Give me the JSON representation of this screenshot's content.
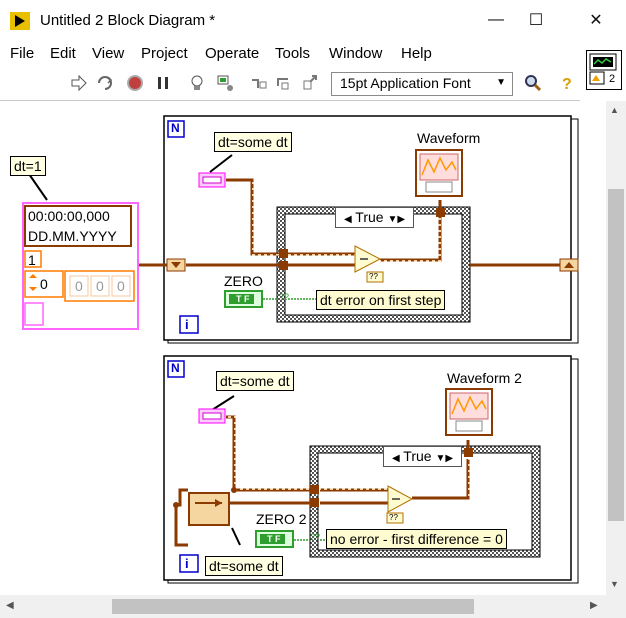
{
  "window": {
    "title": "Untitled 2 Block Diagram *",
    "controls": {
      "minimize": "—",
      "maximize": "☐",
      "close": "✕"
    }
  },
  "menu": [
    "File",
    "Edit",
    "View",
    "Project",
    "Operate",
    "Tools",
    "Window",
    "Help"
  ],
  "toolbar": {
    "font_select": "15pt Application Font",
    "icons": [
      "run-arrow-icon",
      "run-continuously-icon",
      "abort-icon",
      "pause-icon",
      "highlight-bulb-icon",
      "retain-wire-icon",
      "step-into-icon",
      "step-over-icon",
      "step-out-icon",
      "search-icon",
      "help-icon"
    ]
  },
  "context_help": {
    "badge": "2"
  },
  "diagram": {
    "outer_label": "dt=1",
    "timestamp": {
      "time": "00:00:00,000",
      "date": "DD.MM.YYYY"
    },
    "cluster": {
      "n": "1",
      "index": "0",
      "values": [
        "0",
        "0",
        "0"
      ]
    },
    "loop1": {
      "n_terminal": "N",
      "i_terminal": "i",
      "dt_label": "dt=some dt",
      "graph_label": "Waveform",
      "case_value": "True",
      "bool_label": "ZERO",
      "bool_text": "T F",
      "string_const": "dt error on first step",
      "unknown": "??"
    },
    "loop2": {
      "n_terminal": "N",
      "i_terminal": "i",
      "dt_label": "dt=some dt",
      "dt_label_bottom": "dt=some dt",
      "graph_label": "Waveform 2",
      "case_value": "True",
      "bool_label": "ZERO 2",
      "bool_text": "T F",
      "string_const": "no error - first difference = 0",
      "unknown": "??"
    }
  },
  "colors": {
    "wire_waveform": "#8b3a00",
    "wire_numeric": "#ff7b00",
    "wire_bool": "#2e9e2e",
    "timestamp_pink": "#ff66ff",
    "loop_border": "#000000"
  }
}
